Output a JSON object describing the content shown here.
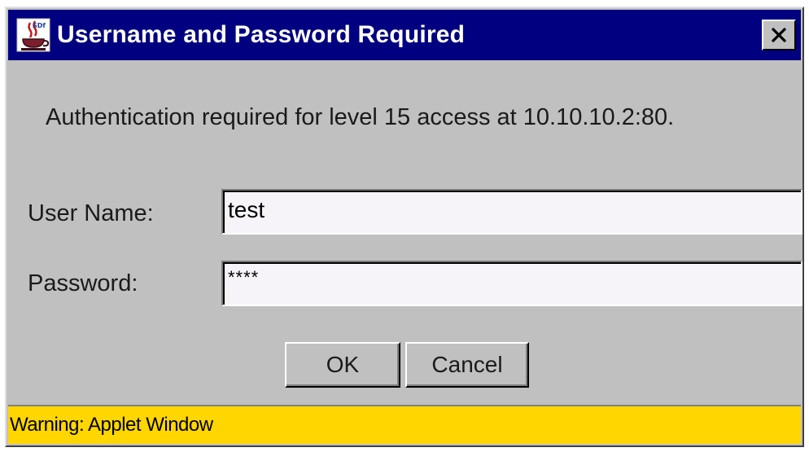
{
  "window": {
    "title": "Username and Password Required",
    "close_glyph": "✕",
    "icon": "java-applet-icon",
    "title_bar_color": "#000080"
  },
  "dialog": {
    "message": "Authentication required for level 15 access at 10.10.10.2:80.",
    "username_label": "User Name:",
    "username_value": "test",
    "password_label": "Password:",
    "password_value": "****",
    "ok_label": "OK",
    "cancel_label": "Cancel"
  },
  "status_bar": {
    "text": "Warning: Applet Window",
    "color": "#ffd600"
  }
}
